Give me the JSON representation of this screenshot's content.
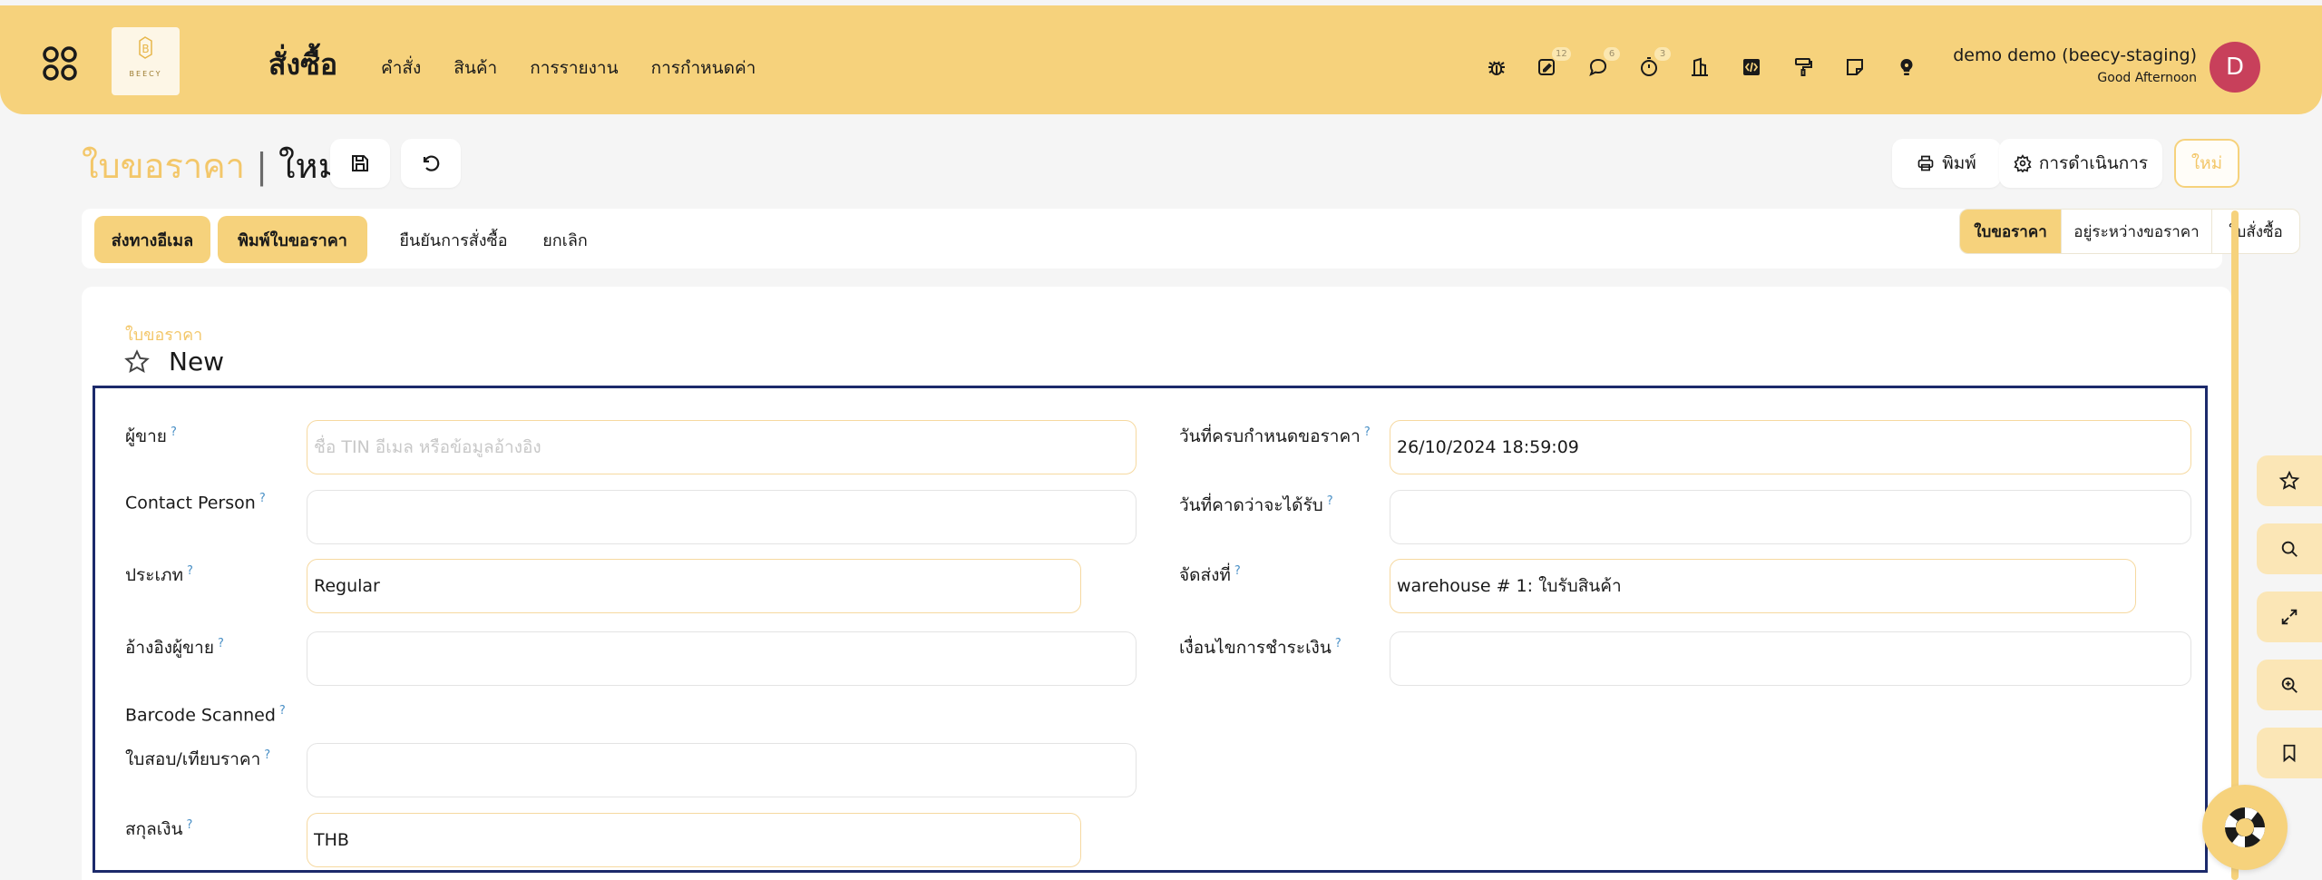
{
  "nav": {
    "logo_letter": "B",
    "logo_text": "BEECY",
    "title": "สั่งซื้อ",
    "menu": [
      "คำสั่ง",
      "สินค้า",
      "การรายงาน",
      "การกำหนดค่า"
    ],
    "icons": [
      {
        "name": "bug-icon"
      },
      {
        "name": "edit-note-icon",
        "badge": "12"
      },
      {
        "name": "chat-icon",
        "badge": "6"
      },
      {
        "name": "timer-icon",
        "badge": "3"
      },
      {
        "name": "building-icon"
      },
      {
        "name": "code-icon"
      },
      {
        "name": "paint-roller-icon"
      },
      {
        "name": "sticky-note-icon"
      },
      {
        "name": "lightbulb-icon"
      }
    ],
    "user_name": "demo demo (beecy-staging)",
    "greeting": "Good Afternoon",
    "avatar_initial": "D"
  },
  "header": {
    "doctype": "ใบขอราคา",
    "separator": "|",
    "title": "ใหม่",
    "print_label": "พิมพ์",
    "actions_label": "การดำเนินการ",
    "new_label": "ใหม่"
  },
  "actions": {
    "send_email": "ส่งทางอีเมล",
    "print_quotation": "พิมพ์ใบขอราคา",
    "confirm_order": "ยืนยันการสั่งซื้อ",
    "cancel": "ยกเลิก"
  },
  "status_steps": {
    "items": [
      "ใบขอราคา",
      "อยู่ระหว่างขอราคา",
      "ใบสั่งซื้อ"
    ],
    "active_index": 0
  },
  "card": {
    "breadcrumb": "ใบขอราคา",
    "title": "New"
  },
  "form": {
    "help_mark": "?",
    "vendor": {
      "label": "ผู้ขาย",
      "placeholder": "ชื่อ TIN อีเมล หรือข้อมูลอ้างอิง",
      "value": ""
    },
    "contact_person": {
      "label": "Contact Person",
      "value": ""
    },
    "type": {
      "label": "ประเภท",
      "value": "Regular"
    },
    "vendor_ref": {
      "label": "อ้างอิงผู้ขาย",
      "value": ""
    },
    "barcode_scanned": {
      "label": "Barcode Scanned"
    },
    "quotation_compare": {
      "label": "ใบสอบ/เทียบราคา",
      "value": ""
    },
    "currency": {
      "label": "สกุลเงิน",
      "value": "THB"
    },
    "deadline": {
      "label": "วันที่ครบกำหนดขอราคา",
      "value": "26/10/2024 18:59:09"
    },
    "expected_arrival": {
      "label": "วันที่คาดว่าจะได้รับ",
      "value": ""
    },
    "deliver_to": {
      "label": "จัดส่งที่",
      "value": "warehouse # 1: ใบรับสินค้า"
    },
    "payment_terms": {
      "label": "เงื่อนไขการชำระเงิน",
      "value": ""
    }
  },
  "side_tools": [
    "star-icon",
    "search-icon",
    "expand-icon",
    "zoom-in-icon",
    "bookmark-icon"
  ],
  "colors": {
    "accent": "#f6d27c",
    "accent_text": "#f3c76a",
    "avatar": "#c8405b",
    "focus_border": "#1c2a6b"
  }
}
